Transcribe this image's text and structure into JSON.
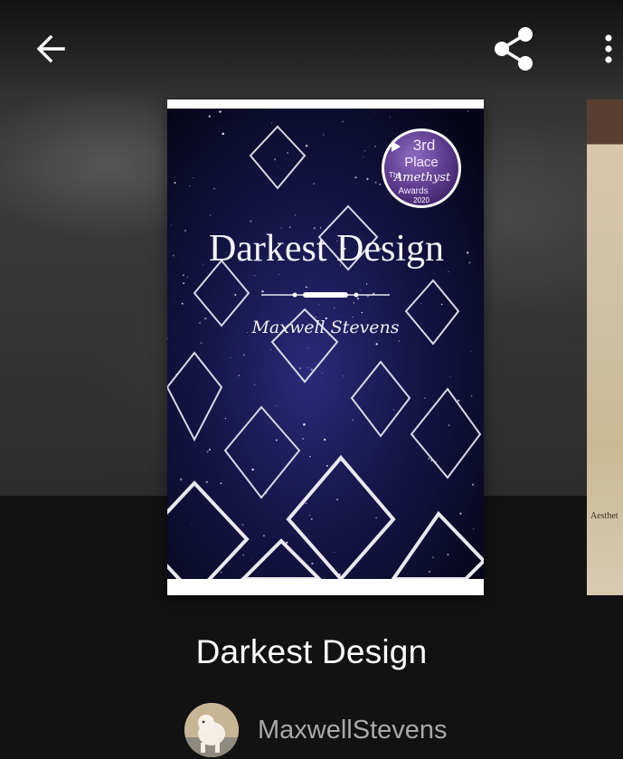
{
  "header": {
    "back_icon": "arrow-left-icon",
    "share_icon": "share-icon",
    "more_icon": "more-vertical-icon"
  },
  "cover": {
    "title": "Darkest Design",
    "author": "Maxwell Stevens",
    "badge": {
      "line1": "3rd",
      "line2": "Place",
      "line3": "The",
      "line4": "Amethyst",
      "line5": "Awards",
      "line6": "2020"
    }
  },
  "next_cover": {
    "partial_text": "Aesthet"
  },
  "story": {
    "title": "Darkest Design",
    "author_name": "MaxwellStevens"
  },
  "colors": {
    "background": "#121212",
    "cover_night": "#0b0b2e",
    "badge_purple": "#5b3a8c",
    "author_text": "#a9a9a9"
  }
}
